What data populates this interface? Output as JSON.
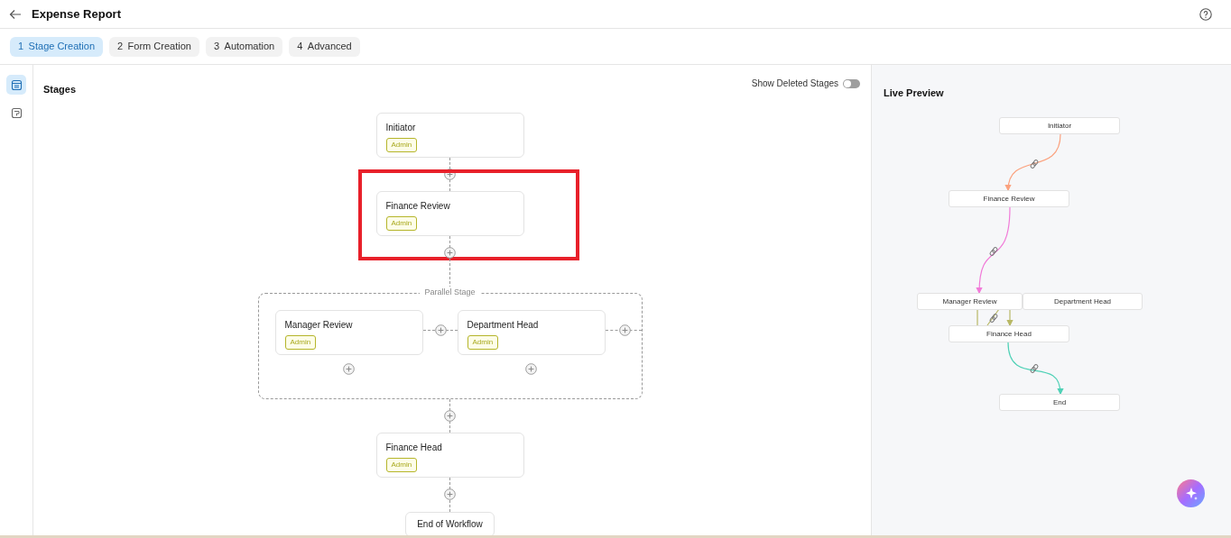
{
  "header": {
    "title": "Expense Report"
  },
  "steps": [
    {
      "number": "1",
      "label": "Stage Creation",
      "selected": true
    },
    {
      "number": "2",
      "label": "Form Creation",
      "selected": false
    },
    {
      "number": "3",
      "label": "Automation",
      "selected": false
    },
    {
      "number": "4",
      "label": "Advanced",
      "selected": false
    }
  ],
  "rail": [
    {
      "selected": true
    },
    {
      "selected": false
    }
  ],
  "stages_panel": {
    "title": "Stages",
    "show_deleted": {
      "label": "Show Deleted Stages",
      "on": false
    },
    "flow": [
      {
        "kind": "stage",
        "name": "Initiator",
        "role": "Admin",
        "highlighted": false
      },
      {
        "kind": "stage",
        "name": "Finance Review",
        "role": "Admin",
        "highlighted": true
      },
      {
        "kind": "parallel",
        "label": "Parallel Stage",
        "branches": [
          {
            "name": "Manager Review",
            "role": "Admin"
          },
          {
            "name": "Department Head",
            "role": "Admin"
          }
        ]
      },
      {
        "kind": "stage",
        "name": "Finance Head",
        "role": "Admin",
        "highlighted": false
      },
      {
        "kind": "end",
        "name": "End of Workflow"
      }
    ]
  },
  "live_preview": {
    "title": "Live Preview",
    "nodes": [
      "Initiator",
      "Finance Review",
      "Manager Review",
      "Department Head",
      "Finance Head",
      "End"
    ],
    "edges": [
      {
        "color": "#fba27f"
      },
      {
        "color": "#f17bd8"
      },
      {
        "color": "#b8b865"
      },
      {
        "color": "#4fd1b6"
      }
    ]
  }
}
